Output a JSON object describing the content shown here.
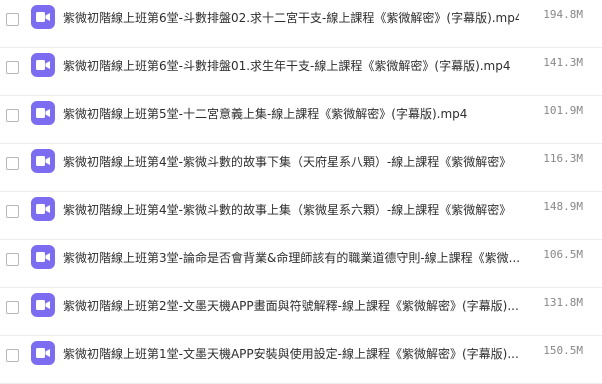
{
  "files": [
    {
      "name": "紫微初階線上班第6堂-斗數排盤02.求十二宮干支-線上課程《紫微解密》(字幕版).mp4",
      "size": "194.8M",
      "icon": "video-file-icon"
    },
    {
      "name": "紫微初階線上班第6堂-斗數排盤01.求生年干支-線上課程《紫微解密》(字幕版).mp4",
      "size": "141.3M",
      "icon": "video-file-icon"
    },
    {
      "name": "紫微初階線上班第5堂-十二宮意義上集-線上課程《紫微解密》(字幕版).mp4",
      "size": "101.9M",
      "icon": "video-file-icon"
    },
    {
      "name": "紫微初階線上班第4堂-紫微斗數的故事下集（天府星系八顆）-線上課程《紫微解密》",
      "size": "116.3M",
      "icon": "video-file-icon"
    },
    {
      "name": "紫微初階線上班第4堂-紫微斗數的故事上集（紫微星系六顆）-線上課程《紫微解密》",
      "size": "148.9M",
      "icon": "video-file-icon"
    },
    {
      "name": "紫微初階線上班第3堂-論命是否會背業&命理師該有的職業道德守則-線上課程《紫微...",
      "size": "106.5M",
      "icon": "video-file-icon"
    },
    {
      "name": "紫微初階線上班第2堂-文墨天機APP畫面與符號解釋-線上課程《紫微解密》(字幕版)...",
      "size": "131.8M",
      "icon": "video-file-icon"
    },
    {
      "name": "紫微初階線上班第1堂-文墨天機APP安裝與使用設定-線上課程《紫微解密》(字幕版)...",
      "size": "150.5M",
      "icon": "video-file-icon"
    }
  ],
  "colors": {
    "icon_bg": "#7b6cf0",
    "text": "#2e2e2e",
    "size_text": "#888888"
  }
}
